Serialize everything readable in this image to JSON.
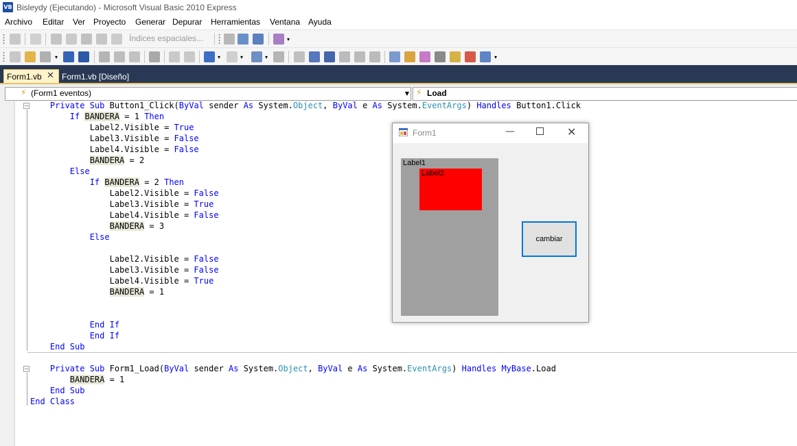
{
  "window": {
    "title": "Bisleydy (Ejecutando) - Microsoft Visual Basic 2010 Express",
    "icon": "vb-icon",
    "icon_text": "VB"
  },
  "menu": [
    "Archivo",
    "Editar",
    "Ver",
    "Proyecto",
    "Generar",
    "Depurar",
    "Herramientas",
    "Ventana",
    "Ayuda"
  ],
  "toolbar": {
    "index_label": "Índices espaciales..."
  },
  "tabs": [
    {
      "label": "Form1.vb",
      "active": true
    },
    {
      "label": "Form1.vb [Diseño]",
      "active": false
    }
  ],
  "navbar": {
    "left": "(Form1 eventos)",
    "right": "Load"
  },
  "code": [
    [
      {
        "t": "    "
      },
      {
        "t": "Private Sub",
        "c": "kw"
      },
      {
        "t": " Button1_Click("
      },
      {
        "t": "ByVal",
        "c": "kw"
      },
      {
        "t": " sender "
      },
      {
        "t": "As",
        "c": "kw"
      },
      {
        "t": " System."
      },
      {
        "t": "Object",
        "c": "ty"
      },
      {
        "t": ", "
      },
      {
        "t": "ByVal",
        "c": "kw"
      },
      {
        "t": " e "
      },
      {
        "t": "As",
        "c": "kw"
      },
      {
        "t": " System."
      },
      {
        "t": "EventArgs",
        "c": "ty"
      },
      {
        "t": ") "
      },
      {
        "t": "Handles",
        "c": "kw"
      },
      {
        "t": " Button1.Click"
      }
    ],
    [
      {
        "t": "        "
      },
      {
        "t": "If",
        "c": "kw"
      },
      {
        "t": " "
      },
      {
        "t": "BANDERA",
        "c": "hl"
      },
      {
        "t": " = 1 "
      },
      {
        "t": "Then",
        "c": "kw"
      }
    ],
    [
      {
        "t": "            Label2.Visible = "
      },
      {
        "t": "True",
        "c": "kw"
      }
    ],
    [
      {
        "t": "            Label3.Visible = "
      },
      {
        "t": "False",
        "c": "kw"
      }
    ],
    [
      {
        "t": "            Label4.Visible = "
      },
      {
        "t": "False",
        "c": "kw"
      }
    ],
    [
      {
        "t": "            "
      },
      {
        "t": "BANDERA",
        "c": "hl"
      },
      {
        "t": " = 2"
      }
    ],
    [
      {
        "t": "        "
      },
      {
        "t": "Else",
        "c": "kw"
      }
    ],
    [
      {
        "t": "            "
      },
      {
        "t": "If",
        "c": "kw"
      },
      {
        "t": " "
      },
      {
        "t": "BANDERA",
        "c": "hl"
      },
      {
        "t": " = 2 "
      },
      {
        "t": "Then",
        "c": "kw"
      }
    ],
    [
      {
        "t": "                Label2.Visible = "
      },
      {
        "t": "False",
        "c": "kw"
      }
    ],
    [
      {
        "t": "                Label3.Visible = "
      },
      {
        "t": "True",
        "c": "kw"
      }
    ],
    [
      {
        "t": "                Label4.Visible = "
      },
      {
        "t": "False",
        "c": "kw"
      }
    ],
    [
      {
        "t": "                "
      },
      {
        "t": "BANDERA",
        "c": "hl"
      },
      {
        "t": " = 3"
      }
    ],
    [
      {
        "t": "            "
      },
      {
        "t": "Else",
        "c": "kw"
      }
    ],
    [
      {
        "t": ""
      }
    ],
    [
      {
        "t": "                Label2.Visible = "
      },
      {
        "t": "False",
        "c": "kw"
      }
    ],
    [
      {
        "t": "                Label3.Visible = "
      },
      {
        "t": "False",
        "c": "kw"
      }
    ],
    [
      {
        "t": "                Label4.Visible = "
      },
      {
        "t": "True",
        "c": "kw"
      }
    ],
    [
      {
        "t": "                "
      },
      {
        "t": "BANDERA",
        "c": "hl"
      },
      {
        "t": " = 1"
      }
    ],
    [
      {
        "t": ""
      }
    ],
    [
      {
        "t": ""
      }
    ],
    [
      {
        "t": "            "
      },
      {
        "t": "End If",
        "c": "kw"
      }
    ],
    [
      {
        "t": "            "
      },
      {
        "t": "End If",
        "c": "kw"
      }
    ],
    [
      {
        "t": "    "
      },
      {
        "t": "End Sub",
        "c": "kw"
      }
    ],
    [
      {
        "t": ""
      }
    ],
    [
      {
        "t": "    "
      },
      {
        "t": "Private Sub",
        "c": "kw"
      },
      {
        "t": " Form1_Load("
      },
      {
        "t": "ByVal",
        "c": "kw"
      },
      {
        "t": " sender "
      },
      {
        "t": "As",
        "c": "kw"
      },
      {
        "t": " System."
      },
      {
        "t": "Object",
        "c": "ty"
      },
      {
        "t": ", "
      },
      {
        "t": "ByVal",
        "c": "kw"
      },
      {
        "t": " e "
      },
      {
        "t": "As",
        "c": "kw"
      },
      {
        "t": " System."
      },
      {
        "t": "EventArgs",
        "c": "ty"
      },
      {
        "t": ") "
      },
      {
        "t": "Handles",
        "c": "kw"
      },
      {
        "t": " "
      },
      {
        "t": "MyBase",
        "c": "kw"
      },
      {
        "t": ".Load"
      }
    ],
    [
      {
        "t": "        "
      },
      {
        "t": "BANDERA",
        "c": "hl"
      },
      {
        "t": " = 1"
      }
    ],
    [
      {
        "t": "    "
      },
      {
        "t": "End Sub",
        "c": "kw"
      }
    ],
    [
      {
        "t": "End Class",
        "c": "kw"
      }
    ]
  ],
  "form1": {
    "title": "Form1",
    "label1": "Label1",
    "label2": "Label2",
    "button": "cambiar",
    "label1_color": "#a0a0a0",
    "label2_color": "#ff0000",
    "button_border_color": "#0078d7"
  },
  "colors": {
    "tabstrip": "#293955",
    "active_tab": "#fff3c9",
    "keyword": "#0000ff",
    "type": "#2b91af"
  }
}
